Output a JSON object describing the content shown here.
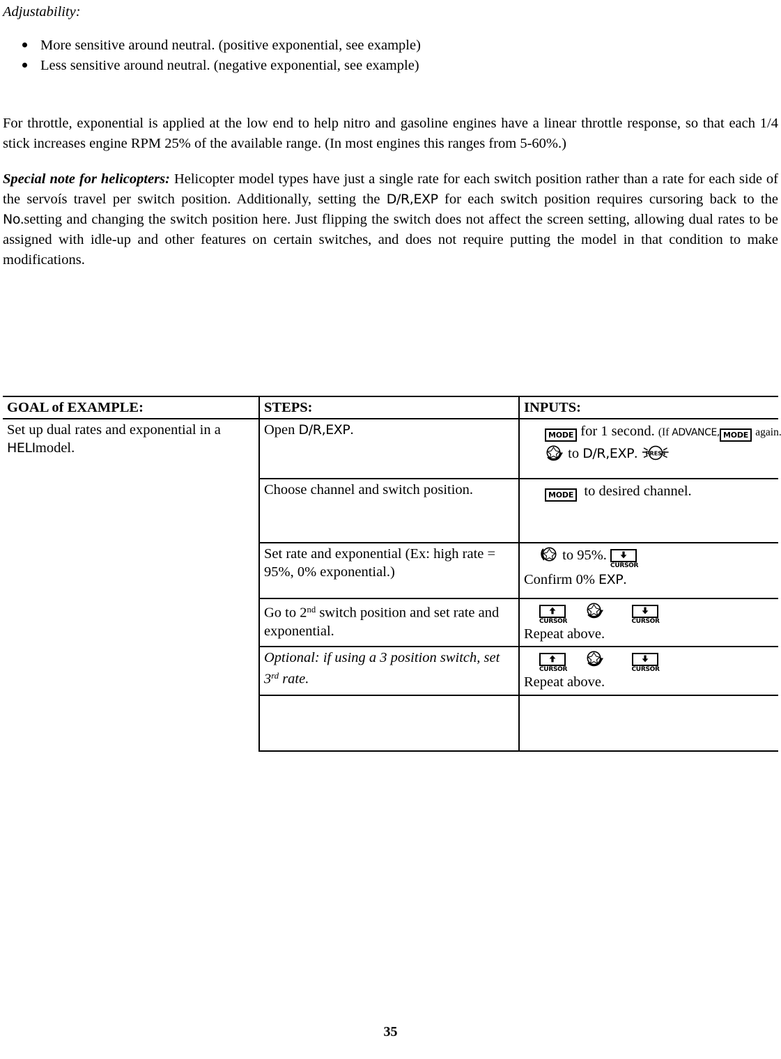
{
  "document": {
    "page_number": "35"
  },
  "intro": {
    "heading": "Adjustability:",
    "bullets": [
      "More sensitive around neutral. (positive exponential, see example)",
      "Less sensitive around neutral. (negative exponential, see example)"
    ],
    "throttle_paragraph": "For throttle, exponential is applied at the low end to help nitro and gasoline engines have a linear throttle response, so that each 1/4 stick increases engine RPM 25% of the available range. (In most engines this ranges from 5-60%.)",
    "heli_note": {
      "label": "Special note for helicopters:",
      "text_1": " Helicopter model types have just a single rate for each switch position rather than a rate for each side of the servoís travel per switch position. Additionally, setting the ",
      "lcd_1": "D/R,EXP",
      "text_2": " for each switch position requires cursoring back to the ",
      "lcd_2": "No.",
      "text_3": "setting and changing the switch position here. Just flipping the switch does not affect the screen setting, allowing dual rates to be assigned with idle-up and other features on certain switches, and does not require putting the model in that condition to make modifications."
    }
  },
  "table": {
    "headers": {
      "goal": "GOAL of EXAMPLE:",
      "steps": "STEPS:",
      "inputs": "INPUTS:"
    },
    "goal": {
      "text_1": "Set up dual rates and exponential in a ",
      "lcd": "HELI",
      "text_2": "model."
    },
    "rows": [
      {
        "step": {
          "text_1": "Open ",
          "lcd": "D/R,EXP",
          "text_2": "."
        },
        "inputs": {
          "line1": {
            "key": "MODE",
            "text_1": "for 1 second.",
            "paren_1": "(If ",
            "caps": "ADVANCE,",
            "key2": "MODE",
            "paren_2": "again.)"
          },
          "line2": {
            "dial": "dial-icon",
            "text_1": "to ",
            "lcd": "D/R,EXP",
            "text_2": ".",
            "press": "PRESS"
          }
        }
      },
      {
        "step": {
          "text_1": "Choose channel and switch position."
        },
        "inputs": {
          "line1": {
            "key": "MODE",
            "text_1": "to desired channel."
          }
        }
      },
      {
        "step": {
          "text_1": "Set rate and exponential (Ex: high rate = 95%, 0% exponential.)"
        },
        "inputs": {
          "line1": {
            "dial": "dial-icon",
            "text_1": "to 95%.",
            "cursor": "CURSOR"
          },
          "line2": {
            "text_1": "Confirm 0% ",
            "lcd": "EXP",
            "text_2": "."
          }
        }
      },
      {
        "step": {
          "text_pre": "Go to 2",
          "ordinal": "nd",
          "text_post": " switch position and set rate and exponential."
        },
        "inputs": {
          "icons": [
            "CURSOR",
            "dial-icon",
            "CURSOR"
          ],
          "line2": {
            "text_1": "Repeat above."
          }
        }
      },
      {
        "step": {
          "text_pre": "Optional: if using a 3 position switch, set 3",
          "ordinal": "rd",
          "text_post": " rate."
        },
        "inputs": {
          "icons": [
            "CURSOR",
            "dial-icon",
            "CURSOR"
          ],
          "line2": {
            "text_1": "Repeat above."
          }
        }
      },
      {
        "step": {
          "text_1": ""
        },
        "inputs": {}
      }
    ]
  },
  "colors": {
    "ink": "#000000",
    "paper": "#ffffff"
  }
}
